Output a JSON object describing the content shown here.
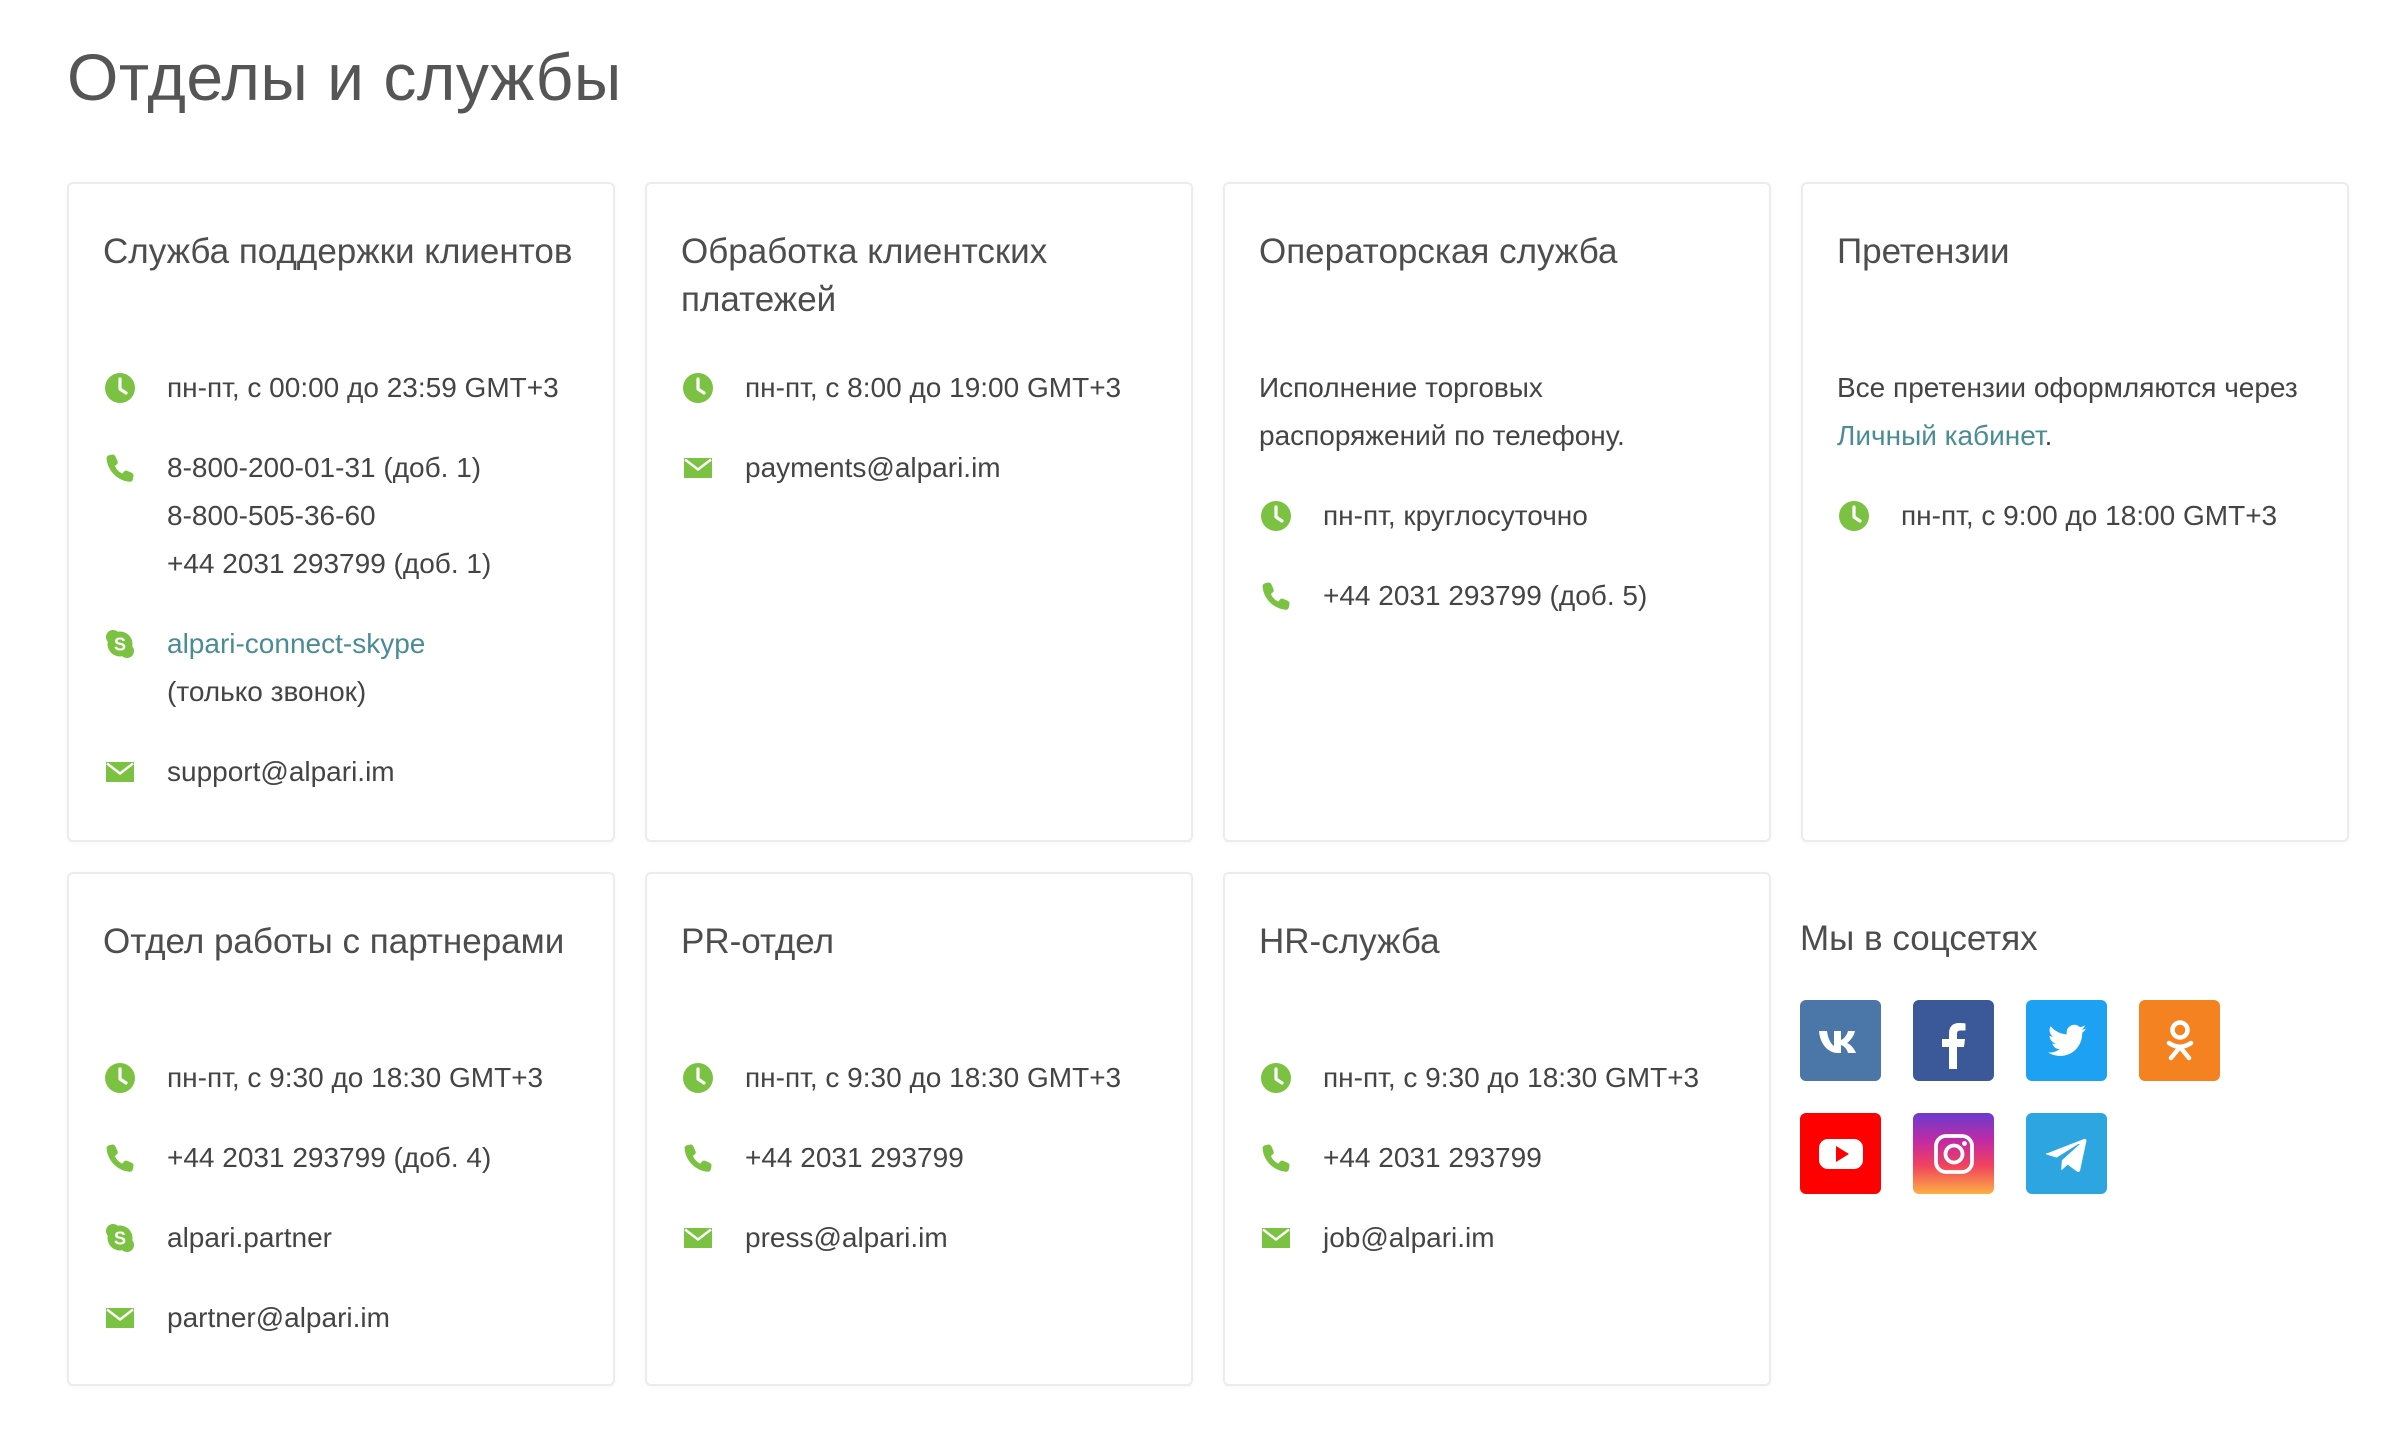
{
  "page": {
    "title": "Отделы и службы"
  },
  "colors": {
    "accent_green": "#7cc242",
    "link": "#4a8c93",
    "text": "#444444",
    "vk": "#4a76a8",
    "facebook": "#3b5998",
    "twitter": "#1da1f2",
    "odnoklassniki": "#f58220",
    "youtube": "#ff0000",
    "telegram": "#2ca5e0"
  },
  "cards": {
    "support": {
      "title": "Служба поддержки клиентов",
      "hours": "пн-пт, с 00:00 до 23:59 GMT+3",
      "phone1": "8-800-200-01-31 (доб. 1)",
      "phone2": "8-800-505-36-60",
      "phone3": "+44 2031 293799 (доб. 1)",
      "skype": "alpari-connect-skype",
      "skype_note": "(только звонок)",
      "email": "support@alpari.im"
    },
    "payments": {
      "title": "Обработка клиентских платежей",
      "hours": "пн-пт, с 8:00 до 19:00 GMT+3",
      "email": "payments@alpari.im"
    },
    "operators": {
      "title": "Операторская служба",
      "description": "Исполнение торговых распоряжений по телефону.",
      "hours": "пн-пт, круглосуточно",
      "phone": "+44 2031 293799 (доб. 5)"
    },
    "claims": {
      "title": "Претензии",
      "description_prefix": "Все претензии оформляются через",
      "cabinet_link": "Личный кабинет",
      "description_suffix": ".",
      "hours": "пн-пт, с 9:00 до 18:00 GMT+3"
    },
    "partners": {
      "title": "Отдел работы с партнерами",
      "hours": "пн-пт, с 9:30 до 18:30 GMT+3",
      "phone": "+44 2031 293799 (доб. 4)",
      "skype": "alpari.partner",
      "email": "partner@alpari.im"
    },
    "pr": {
      "title": "PR-отдел",
      "hours": "пн-пт, с 9:30 до 18:30 GMT+3",
      "phone": "+44 2031 293799",
      "email": "press@alpari.im"
    },
    "hr": {
      "title": "HR-служба",
      "hours": "пн-пт, с 9:30 до 18:30 GMT+3",
      "phone": "+44 2031 293799",
      "email": "job@alpari.im"
    }
  },
  "social": {
    "title": "Мы в соцсетях",
    "icons": [
      "vk-icon",
      "facebook-icon",
      "twitter-icon",
      "odnoklassniki-icon",
      "youtube-icon",
      "instagram-icon",
      "telegram-icon"
    ]
  }
}
